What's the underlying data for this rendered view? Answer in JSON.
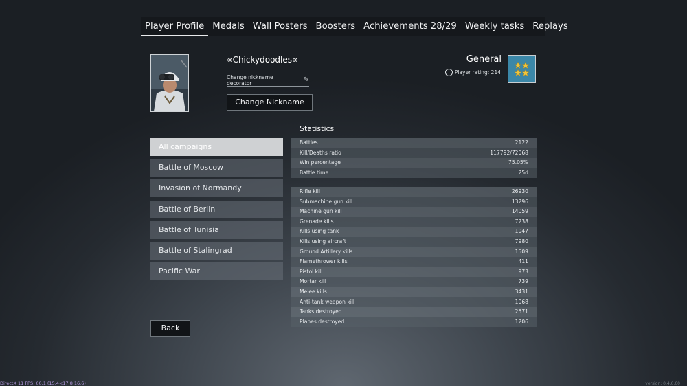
{
  "nav": {
    "tabs": [
      {
        "label": "Player Profile"
      },
      {
        "label": "Medals"
      },
      {
        "label": "Wall Posters"
      },
      {
        "label": "Boosters"
      },
      {
        "label": "Achievements 28/29"
      },
      {
        "label": "Weekly tasks"
      },
      {
        "label": "Replays"
      }
    ]
  },
  "profile": {
    "nickname": "∝Chickydoodles∝",
    "decorator_label": "Change nickname decorator",
    "change_nickname_label": "Change Nickname",
    "rank": "General",
    "rating_label": "Player rating: 214"
  },
  "campaigns": [
    {
      "label": "All campaigns"
    },
    {
      "label": "Battle of Moscow"
    },
    {
      "label": "Invasion of Normandy"
    },
    {
      "label": "Battle of Berlin"
    },
    {
      "label": "Battle of Tunisia"
    },
    {
      "label": "Battle of Stalingrad"
    },
    {
      "label": "Pacific War"
    }
  ],
  "statistics": {
    "title": "Statistics",
    "general": [
      {
        "label": "Battles",
        "value": "2122"
      },
      {
        "label": "Kill/Deaths ratio",
        "value": "117792/72068"
      },
      {
        "label": "Win percentage",
        "value": "75.05%"
      },
      {
        "label": "Battle time",
        "value": "25d"
      }
    ],
    "kills": [
      {
        "label": "Rifle kill",
        "value": "26930"
      },
      {
        "label": "Submachine gun kill",
        "value": "13296"
      },
      {
        "label": "Machine gun kill",
        "value": "14059"
      },
      {
        "label": "Grenade kills",
        "value": "7238"
      },
      {
        "label": "Kills using tank",
        "value": "1047"
      },
      {
        "label": "Kills using aircraft",
        "value": "7980"
      },
      {
        "label": "Ground Artillery kills",
        "value": "1509"
      },
      {
        "label": "Flamethrower kills",
        "value": "411"
      },
      {
        "label": "Pistol kill",
        "value": "973"
      },
      {
        "label": "Mortar kill",
        "value": "739"
      },
      {
        "label": "Melee kills",
        "value": "3431"
      },
      {
        "label": "Anti-tank weapon kill",
        "value": "1068"
      },
      {
        "label": "Tanks destroyed",
        "value": "2571"
      },
      {
        "label": "Planes destroyed",
        "value": "1206"
      }
    ]
  },
  "back_label": "Back",
  "footer": {
    "fps_text": "DirectX 11 FPS: 60.1 (15.4<17.8 16.6)",
    "version_text": "version: 0.4.6.60"
  },
  "colors": {
    "accent_badge": "#3b87a8",
    "star": "#f0c43a"
  }
}
